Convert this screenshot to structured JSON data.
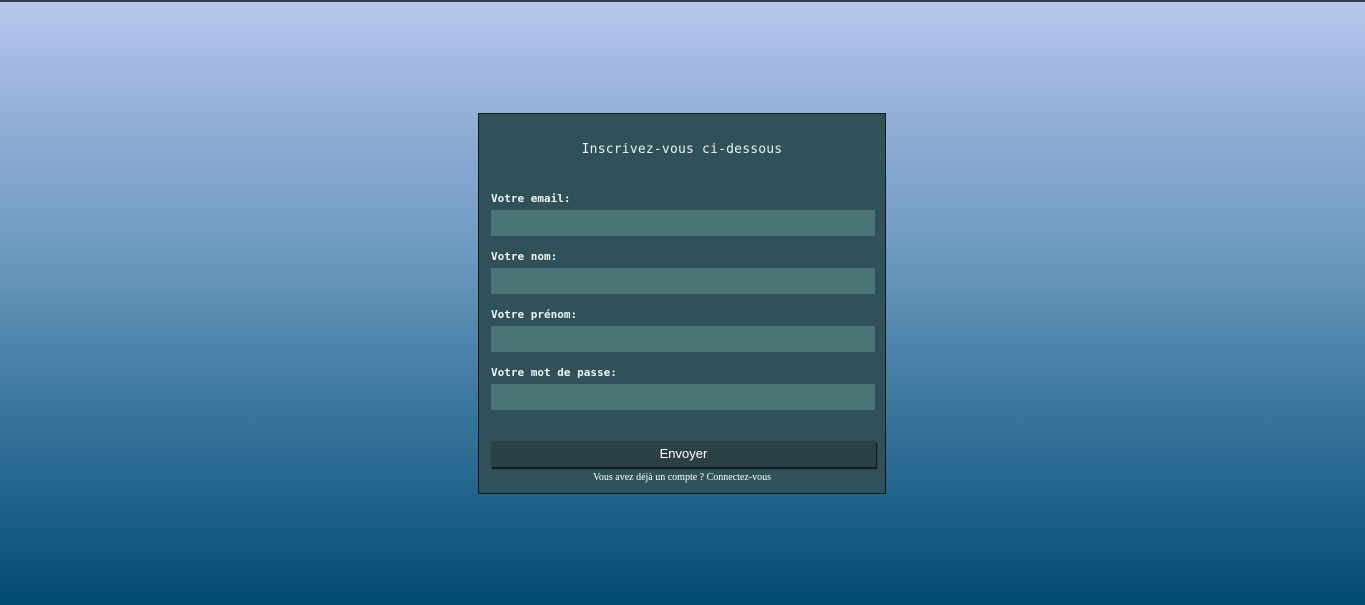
{
  "form": {
    "title": "Inscrivez-vous ci-dessous",
    "email_label": "Votre email:",
    "email_value": "",
    "name_label": "Votre nom:",
    "name_value": "",
    "firstname_label": "Votre prénom:",
    "firstname_value": "",
    "password_label": "Votre mot de passe:",
    "password_value": "",
    "submit_label": "Envoyer",
    "footer_text": "Vous avez déjà un compte ?",
    "footer_link": "Connectez-vous"
  },
  "colors": {
    "card_bg": "#2f5157",
    "field_bg": "#4a7476",
    "button_bg": "#2a4044"
  }
}
